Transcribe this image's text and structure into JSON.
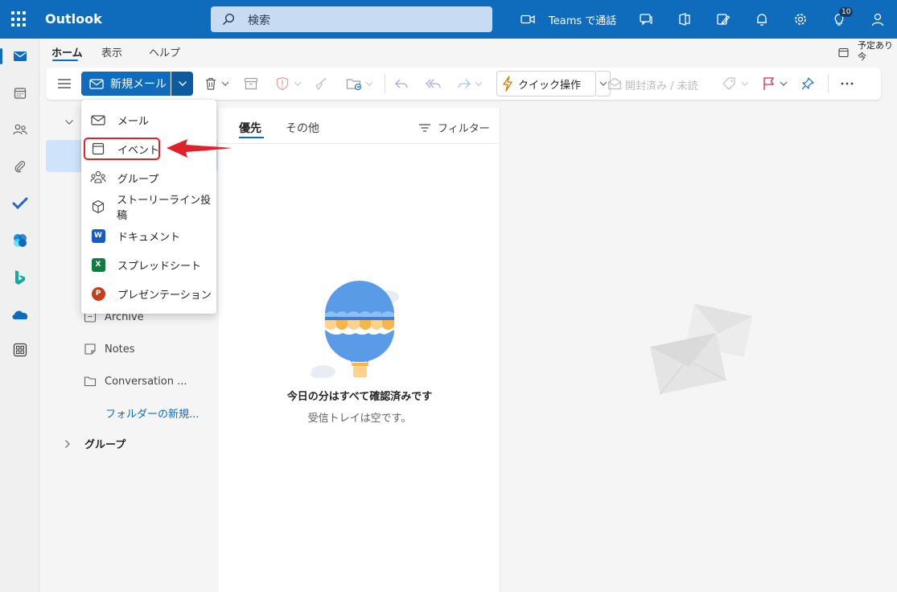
{
  "app": {
    "title": "Outlook"
  },
  "search": {
    "placeholder": "検索"
  },
  "topbar": {
    "teams_label": "Teams で通話",
    "notification_count": "10"
  },
  "ribbon": {
    "tabs": [
      {
        "label": "ホーム",
        "active": true
      },
      {
        "label": "表示"
      },
      {
        "label": "ヘルプ"
      }
    ],
    "schedule_label_line1": "予定あり",
    "schedule_label_line2": "今"
  },
  "toolbar": {
    "new_mail_label": "新規メール",
    "quick_steps_label": "クイック操作",
    "read_unread_label": "開封済み / 未読"
  },
  "new_menu": {
    "items": [
      {
        "label": "メール",
        "icon": "mail-icon"
      },
      {
        "label": "イベント",
        "icon": "calendar-icon",
        "highlighted": true
      },
      {
        "label": "グループ",
        "icon": "group-icon"
      },
      {
        "label": "ストーリーライン投稿",
        "icon": "storyline-icon"
      },
      {
        "label": "ドキュメント",
        "icon": "word-icon"
      },
      {
        "label": "スプレッドシート",
        "icon": "excel-icon"
      },
      {
        "label": "プレゼンテーション",
        "icon": "powerpoint-icon"
      }
    ]
  },
  "folders": {
    "items": [
      {
        "label": "Archive",
        "icon": "archive-icon"
      },
      {
        "label": "Notes",
        "icon": "note-icon"
      },
      {
        "label": "Conversation ...",
        "icon": "folder-icon"
      }
    ],
    "new_folder_label": "フォルダーの新規...",
    "groups_label": "グループ"
  },
  "message_list": {
    "tabs": [
      {
        "label": "優先",
        "active": true
      },
      {
        "label": "その他"
      }
    ],
    "filter_label": "フィルター",
    "empty_title": "今日の分はすべて確認済みです",
    "empty_subtitle": "受信トレイは空です。"
  },
  "colors": {
    "brand": "#0f6cbd",
    "highlight": "#e0202a",
    "word": "#185abd",
    "excel": "#107c41",
    "powerpoint": "#c43e1c"
  }
}
